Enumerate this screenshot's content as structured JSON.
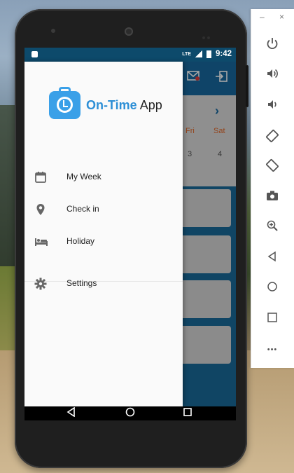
{
  "app": {
    "logo_brand": "On-Time",
    "logo_rest": " App"
  },
  "status_bar": {
    "network": "LTE",
    "time": "9:42"
  },
  "drawer": {
    "items": [
      {
        "label": "My Week",
        "icon": "calendar-icon"
      },
      {
        "label": "Check in",
        "icon": "location-pin-icon"
      },
      {
        "label": "Holiday",
        "icon": "bed-icon"
      },
      {
        "label": "Settings",
        "icon": "gear-icon"
      }
    ]
  },
  "calendar": {
    "next_label": "›",
    "days": [
      {
        "name": "Fri",
        "num": "3"
      },
      {
        "name": "Sat",
        "num": "4"
      }
    ]
  },
  "emulator_panel": {
    "minimize": "–",
    "close": "×",
    "buttons": [
      "power-icon",
      "volume-up-icon",
      "volume-down-icon",
      "rotate-left-icon",
      "rotate-right-icon",
      "camera-icon",
      "zoom-icon",
      "back-icon",
      "home-icon",
      "overview-icon",
      "more-icon"
    ],
    "more_label": "•••"
  },
  "colors": {
    "appbar": "#1769a0",
    "accent": "#2d8fd6",
    "weekend": "#e26a2c"
  }
}
